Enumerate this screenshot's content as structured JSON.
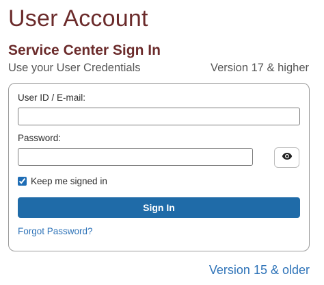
{
  "header": {
    "title": "User Account",
    "section_title": "Service Center Sign In",
    "subtitle": "Use your User Credentials",
    "version_current": "Version 17 & higher"
  },
  "form": {
    "user_id_label": "User ID / E-mail:",
    "user_id_value": "",
    "password_label": "Password:",
    "password_value": "",
    "show_password_icon": "eye-icon",
    "remember_label": "Keep me signed in",
    "remember_checked": true,
    "signin_label": "Sign In",
    "forgot_label": "Forgot Password?"
  },
  "footer": {
    "older_version_link": "Version 15 & older"
  },
  "colors": {
    "title": "#6b2b2b",
    "primary_button": "#1f6ba8",
    "link": "#2e73b8"
  }
}
